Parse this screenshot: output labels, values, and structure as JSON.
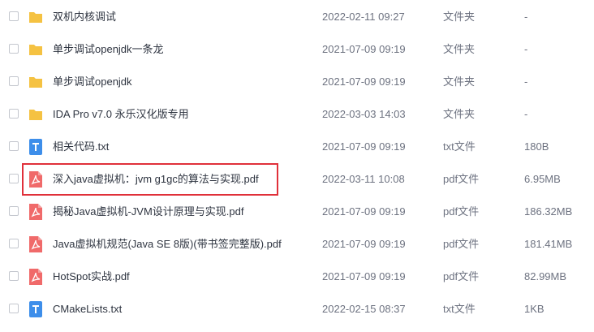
{
  "files": [
    {
      "icon": "folder-icon",
      "name": "双机内核调试",
      "date": "2022-02-11 09:27",
      "type": "文件夹",
      "size": "-"
    },
    {
      "icon": "folder-icon",
      "name": "单步调试openjdk一条龙",
      "date": "2021-07-09 09:19",
      "type": "文件夹",
      "size": "-"
    },
    {
      "icon": "folder-icon",
      "name": "单步调试openjdk",
      "date": "2021-07-09 09:19",
      "type": "文件夹",
      "size": "-"
    },
    {
      "icon": "folder-icon",
      "name": "IDA Pro v7.0 永乐汉化版专用",
      "date": "2022-03-03 14:03",
      "type": "文件夹",
      "size": "-"
    },
    {
      "icon": "txt-file-icon",
      "name": "相关代码.txt",
      "date": "2021-07-09 09:19",
      "type": "txt文件",
      "size": "180B"
    },
    {
      "icon": "pdf-file-icon",
      "name": "深入java虚拟机：jvm g1gc的算法与实现.pdf",
      "date": "2022-03-11 10:08",
      "type": "pdf文件",
      "size": "6.95MB"
    },
    {
      "icon": "pdf-file-icon",
      "name": "揭秘Java虚拟机-JVM设计原理与实现.pdf",
      "date": "2021-07-09 09:19",
      "type": "pdf文件",
      "size": "186.32MB"
    },
    {
      "icon": "pdf-file-icon",
      "name": "Java虚拟机规范(Java SE 8版)(带书签完整版).pdf",
      "date": "2021-07-09 09:19",
      "type": "pdf文件",
      "size": "181.41MB"
    },
    {
      "icon": "pdf-file-icon",
      "name": "HotSpot实战.pdf",
      "date": "2021-07-09 09:19",
      "type": "pdf文件",
      "size": "82.99MB"
    },
    {
      "icon": "txt-file-icon",
      "name": "CMakeLists.txt",
      "date": "2022-02-15 08:37",
      "type": "txt文件",
      "size": "1KB"
    }
  ],
  "colors": {
    "folder": "#f5c242",
    "txt": "#3d8eea",
    "pdf": "#f06a6a",
    "highlight": "#e0303a"
  }
}
